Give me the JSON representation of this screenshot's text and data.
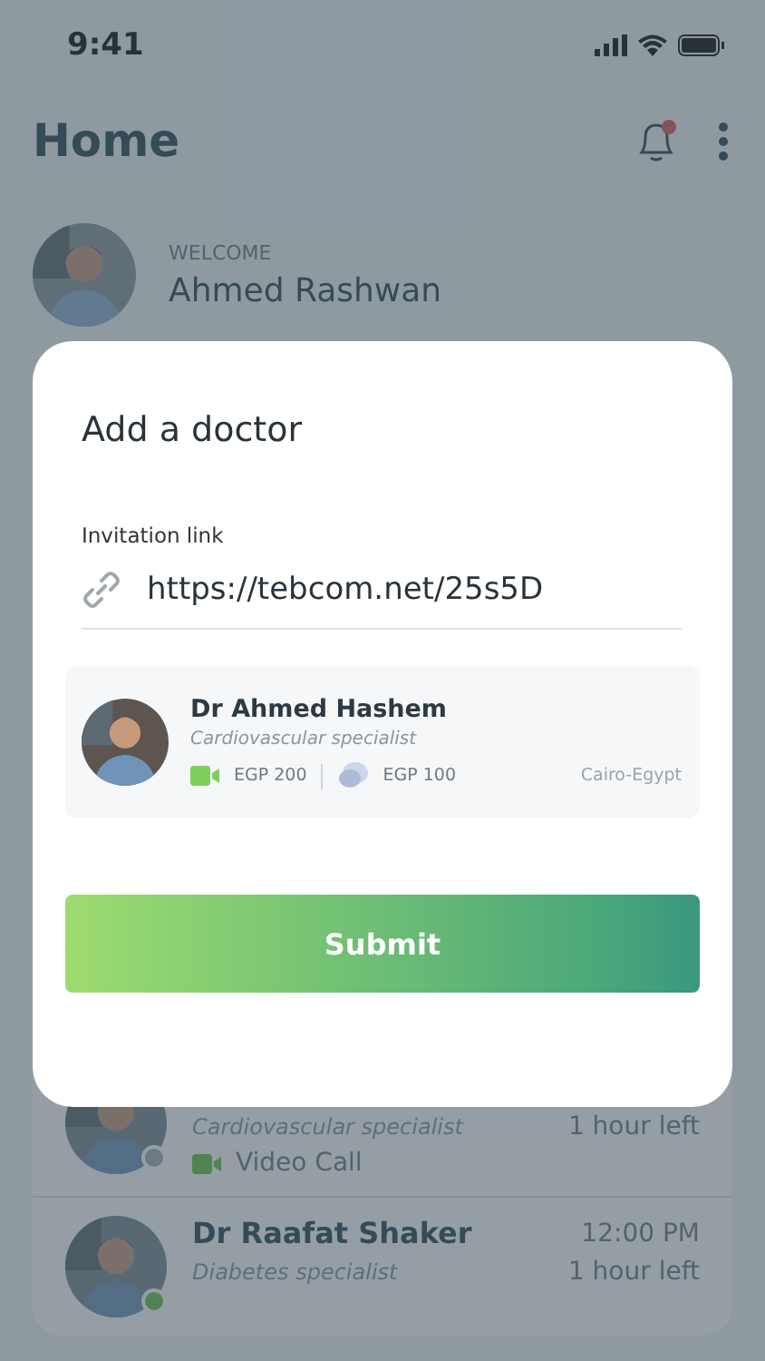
{
  "status_bar": {
    "time": "9:41"
  },
  "header": {
    "title": "Home",
    "has_notification": true
  },
  "welcome": {
    "label": "WELCOME",
    "name": "Ahmed Rashwan"
  },
  "appointments": [
    {
      "specialty": "Cardiovascular specialist",
      "remaining": "1 hour left",
      "call_type": "Video Call",
      "online": false
    },
    {
      "name": "Dr Raafat Shaker",
      "time": "12:00 PM",
      "specialty": "Diabetes specialist",
      "remaining": "1 hour left",
      "online": true
    }
  ],
  "dialog": {
    "title": "Add a doctor",
    "link_label": "Invitation link",
    "link_value": "https://tebcom.net/25s5D",
    "doctor": {
      "name": "Dr Ahmed Hashem",
      "specialty": "Cardiovascular specialist",
      "video_price": "EGP 200",
      "chat_price": "EGP 100",
      "location": "Cairo-Egypt"
    },
    "submit": "Submit"
  }
}
